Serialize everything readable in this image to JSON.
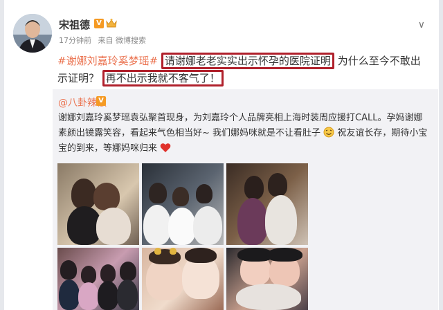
{
  "post": {
    "username": "宋祖德",
    "vip_badge": "V",
    "meta": {
      "time": "17分钟前",
      "source": "来自 微博搜索"
    },
    "hashtag": "#谢娜刘嘉玲奚梦瑶#",
    "boxed_1": "请谢娜老老实实出示怀孕的医院证明",
    "text_mid": "为什么至今不敢出示证明？",
    "boxed_2": "再不出示我就不客气了！"
  },
  "repost": {
    "username": "@八卦辣椒",
    "vip_badge": "V",
    "text_1": "谢娜刘嘉玲奚梦瑶袁弘聚首现身，为刘嘉玲个人品牌亮相上海时装周应援打CALL。孕妈谢娜素颜出镜露笑容，看起来气色相当好~ 我们娜妈咪就是不让看肚子",
    "text_2": "祝友谊长存，期待小宝宝的到来，等娜妈咪归来"
  },
  "icons": {
    "chevron": "chevron-down-icon",
    "crown": "crown-icon",
    "heart": "heart-icon",
    "smile": "smile-face-icon"
  },
  "colors": {
    "hashtag": "#eb7350",
    "highlight_box": "#b0202b",
    "repost_bg": "#f2f2f5"
  }
}
